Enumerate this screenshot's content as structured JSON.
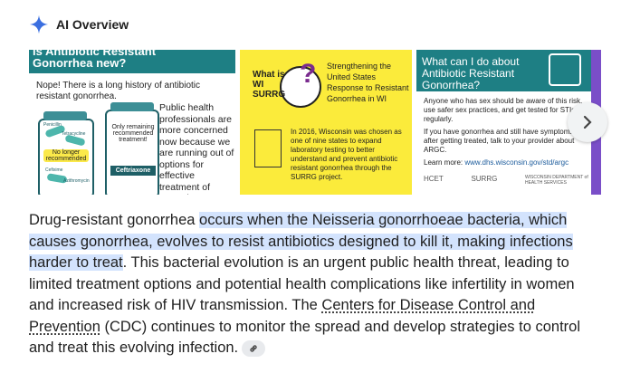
{
  "header": {
    "title": "AI Overview",
    "icon": "gemini-spark-icon"
  },
  "cards": {
    "card1": {
      "title_line1": "is Antibiotic Resistant",
      "title_line2": "Gonorrhea new?",
      "intro": "Nope! There is a long history of antibiotic resistant gonorrhea.",
      "body": "Public health professionals are more concerned now because we are running out of options for effective treatment of gonorrhea.",
      "bottle1_label": "No longer recommended",
      "bottle1_pills": [
        "Penicillin",
        "Tetracycline",
        "Cefixime",
        "Azithromycin"
      ],
      "bottle2_label": "Only remaining recommended treatment!",
      "bottle2_drug": "Ceftriaxone"
    },
    "card2": {
      "question": "What is WI SURRG",
      "question_mark": "?",
      "acronym": "Strengthening the United States Response to Resistant Gonorrhea in WI",
      "body": "In 2016, Wisconsin was chosen as one of nine states to expand laboratory testing to better understand and prevent antibiotic resistant gonorrhea through the SURRG project."
    },
    "card3": {
      "title": "What can I do about Antibiotic Resistant Gonorrhea?",
      "p1": "Anyone who has sex should be aware of this risk, use safer sex practices, and get tested for STIs regularly.",
      "p2": "If you have gonorrhea and still have symptoms after getting treated, talk to your provider about ARGC.",
      "learn_more": "Learn more:",
      "url": "www.dhs.wisconsin.gov/std/argc",
      "logos": [
        "HCET",
        "SURRG",
        "WISCONSIN DEPARTMENT of HEALTH SERVICES"
      ]
    }
  },
  "carousel": {
    "next_icon": "chevron-right-icon"
  },
  "paragraph": {
    "lead": "Drug-resistant gonorrhea ",
    "highlight": "occurs when the Neisseria gonorrhoeae bacteria, which causes gonorrhea, evolves to resist antibiotics designed to kill it, making infections harder to treat",
    "middle": ". This bacterial evolution is an urgent public health threat, leading to limited treatment options and potential health complications like infertility in women and increased risk of HIV transmission. The ",
    "link": "Centers for Disease Control and Prevention",
    "tail": " (CDC) continues to monitor the spread and develop strategies to control and treat this evolving infection.",
    "chip_icon": "link-icon"
  }
}
